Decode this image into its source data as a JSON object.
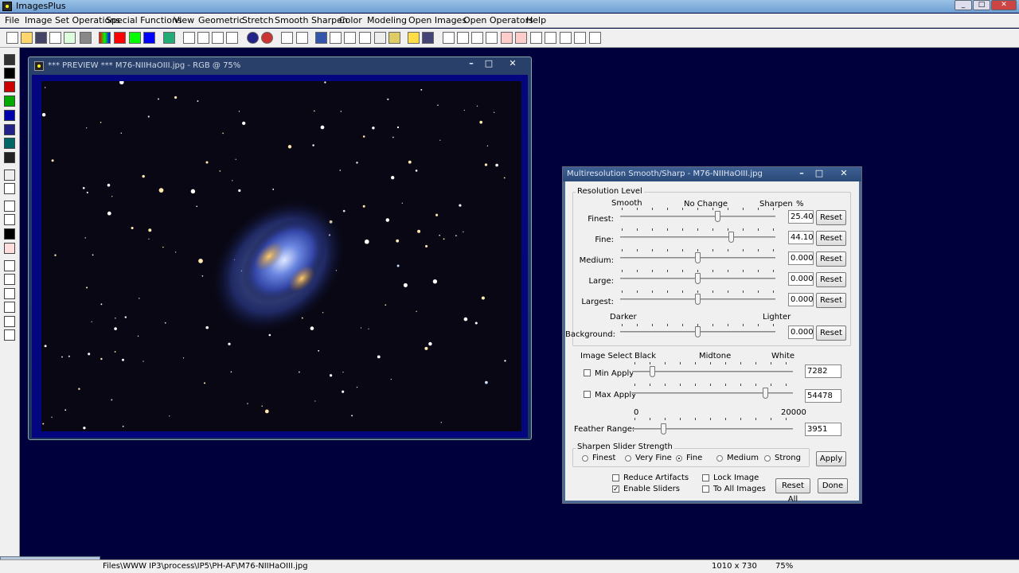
{
  "app": {
    "title": "ImagesPlus"
  },
  "menu": [
    "File",
    "Image Set Operations",
    "Special Functions",
    "View",
    "Geometric",
    "Stretch",
    "Smooth Sharpen",
    "Color",
    "Modeling",
    "Open Images",
    "Open Operators",
    "Help"
  ],
  "preview": {
    "title": "*** PREVIEW *** M76-NIIHaOIII.jpg - RGB @ 75%"
  },
  "dialog": {
    "title": "Multiresolution Smooth/Sharp - M76-NIIHaOIII.jpg",
    "resolution_group": "Resolution Level",
    "hdr_smooth": "Smooth",
    "hdr_nochange": "No Change",
    "hdr_sharpen": "Sharpen",
    "hdr_pct": "%",
    "levels": [
      {
        "label": "Finest:",
        "value": "25.4000",
        "position": 0.63
      },
      {
        "label": "Fine:",
        "value": "44.1000",
        "position": 0.72
      },
      {
        "label": "Medium:",
        "value": "0.0000",
        "position": 0.5
      },
      {
        "label": "Large:",
        "value": "0.0000",
        "position": 0.5
      },
      {
        "label": "Largest:",
        "value": "0.0000",
        "position": 0.5
      }
    ],
    "darker": "Darker",
    "lighter": "Lighter",
    "background": {
      "label": "Background:",
      "value": "0.0000",
      "position": 0.5
    },
    "reset_label": "Reset",
    "image_select": "Image Select",
    "hdr_black": "Black",
    "hdr_midtone": "Midtone",
    "hdr_white": "White",
    "min_apply": {
      "label": "Min Apply",
      "value": "7282",
      "checked": false,
      "position": 0.13
    },
    "max_apply": {
      "label": "Max Apply",
      "value": "54478",
      "checked": false,
      "position": 0.83
    },
    "feather": {
      "label": "Feather Range:",
      "value": "3951",
      "min": "0",
      "max": "20000",
      "position": 0.2
    },
    "strength_group": "Sharpen Slider Strength",
    "strengths": [
      {
        "label": "Finest",
        "selected": false
      },
      {
        "label": "Very Fine",
        "selected": false
      },
      {
        "label": "Fine",
        "selected": true
      },
      {
        "label": "Medium",
        "selected": false
      },
      {
        "label": "Strong",
        "selected": false
      }
    ],
    "apply": "Apply",
    "reduce_artifacts": "Reduce Artifacts",
    "enable_sliders": "Enable Sliders",
    "lock_image": "Lock Image",
    "to_all_images": "To All Images",
    "reset_all": "Reset All",
    "done": "Done"
  },
  "status": {
    "path": "Files\\WWW IP3\\process\\IP5\\PH-AF\\M76-NIIHaOIII.jpg",
    "size": "1010 x 730",
    "zoom": "75%"
  },
  "minimized": {
    "label": "..."
  },
  "colors": {
    "desktop": "#00003c",
    "frame": "#03067e"
  }
}
